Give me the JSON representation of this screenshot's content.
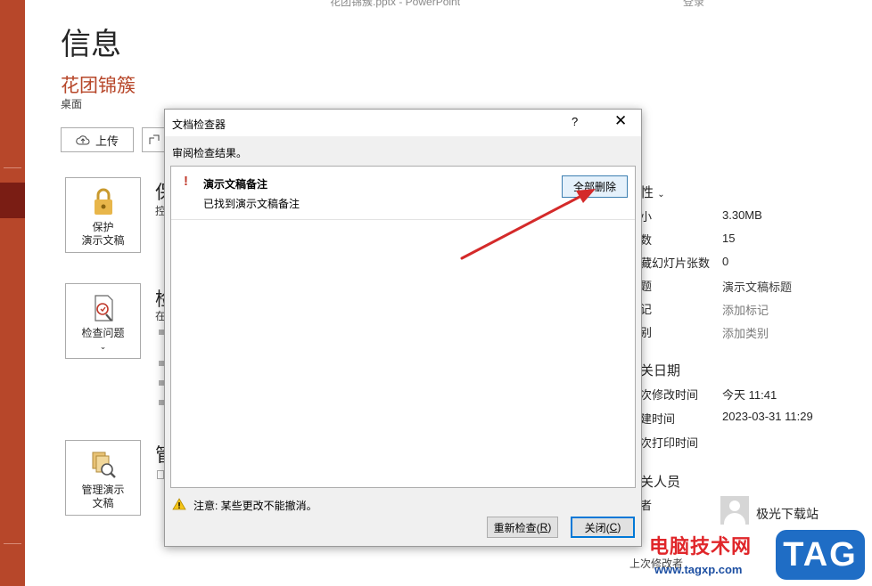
{
  "window": {
    "title": "花团锦簇.pptx  -  PowerPoint",
    "login": "登录"
  },
  "backstage": {
    "page_title": "信息",
    "doc_title": "花团锦簇",
    "doc_location": "桌面",
    "upload_label": "上传",
    "protect": {
      "label_line1": "保护",
      "label_line2": "演示文稿",
      "section_head": "保",
      "section_sub": "控"
    },
    "inspect": {
      "label": "检查问题",
      "section_head": "检",
      "section_sub": "在"
    },
    "manage": {
      "label_line1": "管理演示",
      "label_line2": "文稿",
      "section_head": "管"
    }
  },
  "properties": {
    "header": "性",
    "rows": [
      {
        "label": "小",
        "value": "3.30MB"
      },
      {
        "label": "数",
        "value": "15"
      },
      {
        "label": "藏幻灯片张数",
        "value": "0"
      },
      {
        "label": "题",
        "value": "演示文稿标题"
      },
      {
        "label": "记",
        "value": "添加标记"
      },
      {
        "label": "别",
        "value": "添加类别"
      }
    ],
    "dates_header": "关日期",
    "dates": [
      {
        "label": "次修改时间",
        "value": "今天 11:41"
      },
      {
        "label": "建时间",
        "value": "2023-03-31 11:29"
      },
      {
        "label": "次打印时间",
        "value": ""
      }
    ],
    "people_header": "关人员",
    "author_label": "者",
    "author_name": "极光下载站",
    "last_modified_by": "上次修改者"
  },
  "dialog": {
    "title": "文档检查器",
    "help": "?",
    "close": "✕",
    "instruction": "审阅检查结果。",
    "result_title": "演示文稿备注",
    "result_desc": "已找到演示文稿备注",
    "remove_all": "全部删除",
    "warning": "注意: 某些更改不能撤消。",
    "reinspect": "重新检查(R)",
    "reinspect_main": "重新检查(",
    "reinspect_key": "R",
    "reinspect_end": ")",
    "close_main": "关闭(",
    "close_key": "C",
    "close_end": ")"
  },
  "watermark": {
    "main": "电脑技术网",
    "url": "www.tagxp.com",
    "tag": "TAG"
  },
  "colors": {
    "accent": "#b7472a",
    "nav_selected": "#7a1d14",
    "arrow": "#d42a2a",
    "primary_button_border": "#0078d7"
  }
}
